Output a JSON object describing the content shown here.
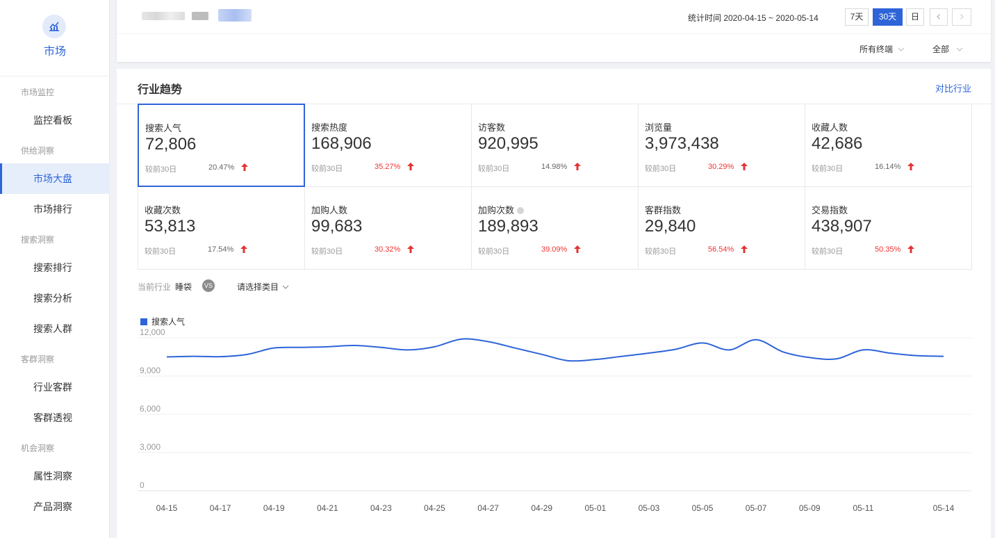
{
  "sidebar": {
    "logo_label": "市场",
    "groups": [
      {
        "title": "市场监控",
        "items": [
          "监控看板"
        ]
      },
      {
        "title": "供给洞察",
        "items": [
          "市场大盘",
          "市场排行"
        ]
      },
      {
        "title": "搜索洞察",
        "items": [
          "搜索排行",
          "搜索分析",
          "搜索人群"
        ]
      },
      {
        "title": "客群洞察",
        "items": [
          "行业客群",
          "客群透视"
        ]
      },
      {
        "title": "机会洞察",
        "items": [
          "属性洞察",
          "产品洞察"
        ]
      }
    ],
    "active_item": "市场大盘"
  },
  "header": {
    "stat_time": "统计时间 2020-04-15 ~ 2020-05-14",
    "range_buttons": [
      "7天",
      "30天",
      "日"
    ],
    "active_range": "30天",
    "prev_icon": "chevron-left-icon",
    "next_icon": "chevron-right-icon",
    "filters": {
      "terminal": "所有终端",
      "scope": "全部"
    }
  },
  "main": {
    "title": "行业趋势",
    "compare_link": "对比行业",
    "metrics": [
      {
        "label": "搜索人气",
        "value": "72,806",
        "compare": "较前30日",
        "pct": "20.47%",
        "trend": "up",
        "selected": true
      },
      {
        "label": "搜索热度",
        "value": "168,906",
        "compare": "较前30日",
        "pct": "35.27%",
        "trend": "up"
      },
      {
        "label": "访客数",
        "value": "920,995",
        "compare": "较前30日",
        "pct": "14.98%",
        "trend": "up"
      },
      {
        "label": "浏览量",
        "value": "3,973,438",
        "compare": "较前30日",
        "pct": "30.29%",
        "trend": "up"
      },
      {
        "label": "收藏人数",
        "value": "42,686",
        "compare": "较前30日",
        "pct": "16.14%",
        "trend": "up"
      },
      {
        "label": "收藏次数",
        "value": "53,813",
        "compare": "较前30日",
        "pct": "17.54%",
        "trend": "up"
      },
      {
        "label": "加购人数",
        "value": "99,683",
        "compare": "较前30日",
        "pct": "30.32%",
        "trend": "up"
      },
      {
        "label": "加购次数",
        "value": "189,893",
        "compare": "较前30日",
        "pct": "39.09%",
        "trend": "up",
        "info": true
      },
      {
        "label": "客群指数",
        "value": "29,840",
        "compare": "较前30日",
        "pct": "56.54%",
        "trend": "up"
      },
      {
        "label": "交易指数",
        "value": "438,907",
        "compare": "较前30日",
        "pct": "50.35%",
        "trend": "up"
      }
    ],
    "arrow_glyph": "🡑",
    "industry": {
      "label": "当前行业",
      "name": "睡袋",
      "vs": "VS",
      "category_placeholder": "请选择类目"
    }
  },
  "colors": {
    "accent": "#2e64d8",
    "up": "#e33333",
    "muted": "#999999"
  },
  "chart_data": {
    "type": "line",
    "legend": "top-left",
    "grid": true,
    "ylim": [
      0,
      12000
    ],
    "yticks": [
      "12,000",
      "9,000",
      "6,000",
      "3,000",
      "0"
    ],
    "xtick_labels": [
      "04-15",
      "04-17",
      "04-19",
      "04-21",
      "04-23",
      "04-25",
      "04-27",
      "04-29",
      "05-01",
      "05-03",
      "05-05",
      "05-07",
      "05-09",
      "05-11",
      "05-14"
    ],
    "x": [
      "04-15",
      "04-16",
      "04-17",
      "04-18",
      "04-19",
      "04-20",
      "04-21",
      "04-22",
      "04-23",
      "04-24",
      "04-25",
      "04-26",
      "04-27",
      "04-28",
      "04-29",
      "04-30",
      "05-01",
      "05-02",
      "05-03",
      "05-04",
      "05-05",
      "05-06",
      "05-07",
      "05-08",
      "05-09",
      "05-10",
      "05-11",
      "05-12",
      "05-13",
      "05-14"
    ],
    "series": [
      {
        "name": "搜索人气",
        "values": [
          10500,
          10550,
          10520,
          10700,
          11200,
          11250,
          11300,
          11400,
          11250,
          11050,
          11300,
          11900,
          11700,
          11200,
          10700,
          10200,
          10300,
          10550,
          10800,
          11100,
          11600,
          11050,
          11850,
          10900,
          10450,
          10350,
          11050,
          10800,
          10600,
          10550
        ]
      }
    ]
  }
}
